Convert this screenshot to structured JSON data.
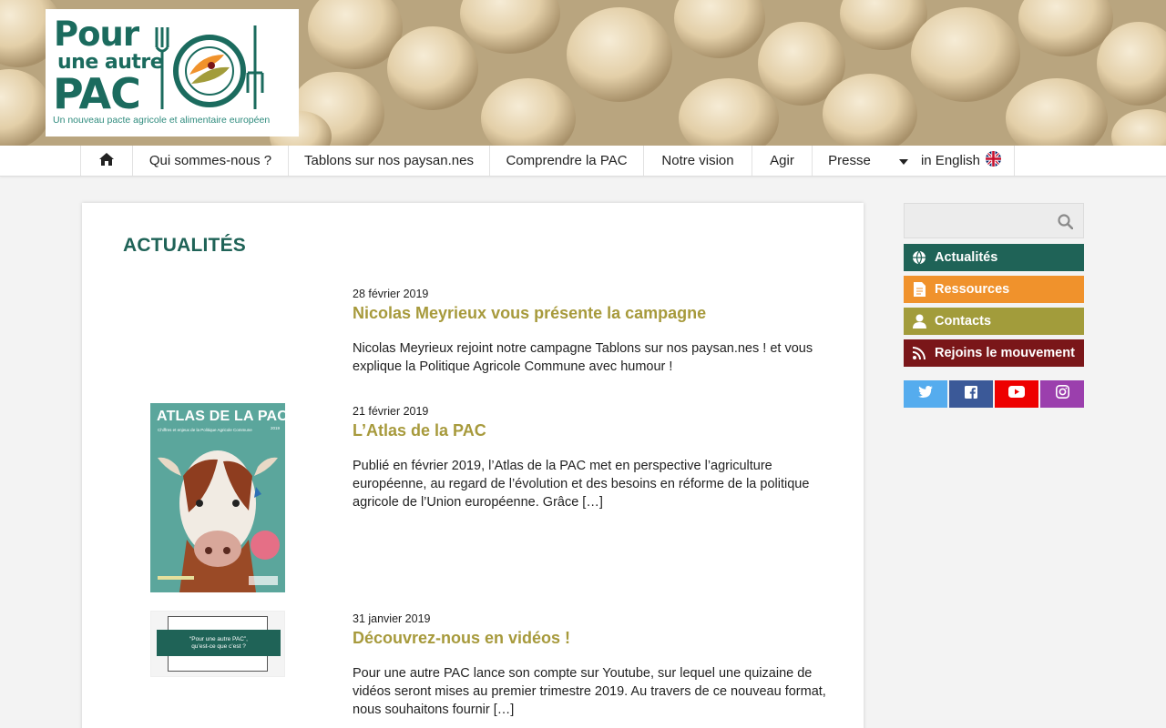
{
  "logo": {
    "line1": "Pour",
    "line2": "une autre",
    "line3": "PAC",
    "tagline": "Un nouveau pacte agricole et alimentaire européen"
  },
  "nav": {
    "home_icon": "home-icon",
    "items": [
      {
        "label": "Qui sommes-nous ?"
      },
      {
        "label": "Tablons sur nos paysan.nes"
      },
      {
        "label": "Comprendre la PAC"
      },
      {
        "label": "Notre vision"
      },
      {
        "label": "Agir"
      },
      {
        "label": "Presse"
      }
    ],
    "language": {
      "label": "in English",
      "icon": "uk-flag-icon"
    }
  },
  "main": {
    "title": "ACTUALITÉS",
    "posts": [
      {
        "date": "28 février 2019",
        "title": "Nicolas Meyrieux vous présente la campagne",
        "excerpt": "Nicolas Meyrieux rejoint notre campagne Tablons sur nos paysan.nes ! et vous explique la Politique Agricole Commune avec humour !"
      },
      {
        "date": "21 février 2019",
        "title": "L’Atlas de la PAC",
        "excerpt": "Publié en février 2019, l’Atlas de la PAC met en perspective l’agriculture européenne, au regard de l’évolution et des besoins en réforme de la politique agricole de l’Union européenne. Grâce […]",
        "thumb": {
          "title": "ATLAS DE LA PAC",
          "subtitle": "Chiffres et enjeux de la Politique Agricole Commune",
          "year": "2019"
        }
      },
      {
        "date": "31 janvier 2019",
        "title": "Découvrez-nous en vidéos !",
        "excerpt": "Pour une autre PAC lance son compte sur Youtube, sur lequel une quizaine de vidéos seront mises au premier trimestre 2019. Au travers de ce nouveau format, nous souhaitons fournir […]",
        "thumb": {
          "line1": "“Pour une autre PAC”,",
          "line2": "qu’est-ce que c’est ?"
        }
      }
    ]
  },
  "sidebar": {
    "search": {
      "placeholder": "",
      "icon": "search-icon"
    },
    "links": [
      {
        "label": "Actualités",
        "icon": "globe-icon",
        "color": "#1f6357"
      },
      {
        "label": "Ressources",
        "icon": "document-icon",
        "color": "#f0922c"
      },
      {
        "label": "Contacts",
        "icon": "user-icon",
        "color": "#a29c3b"
      },
      {
        "label": "Rejoins le mouvement",
        "icon": "rss-icon",
        "color": "#7a1619"
      }
    ],
    "social": [
      {
        "name": "twitter-icon",
        "color": "#55acee"
      },
      {
        "name": "facebook-icon",
        "color": "#3b5998"
      },
      {
        "name": "youtube-icon",
        "color": "#ee0000"
      },
      {
        "name": "instagram-icon",
        "color": "#9b3fad"
      }
    ]
  }
}
